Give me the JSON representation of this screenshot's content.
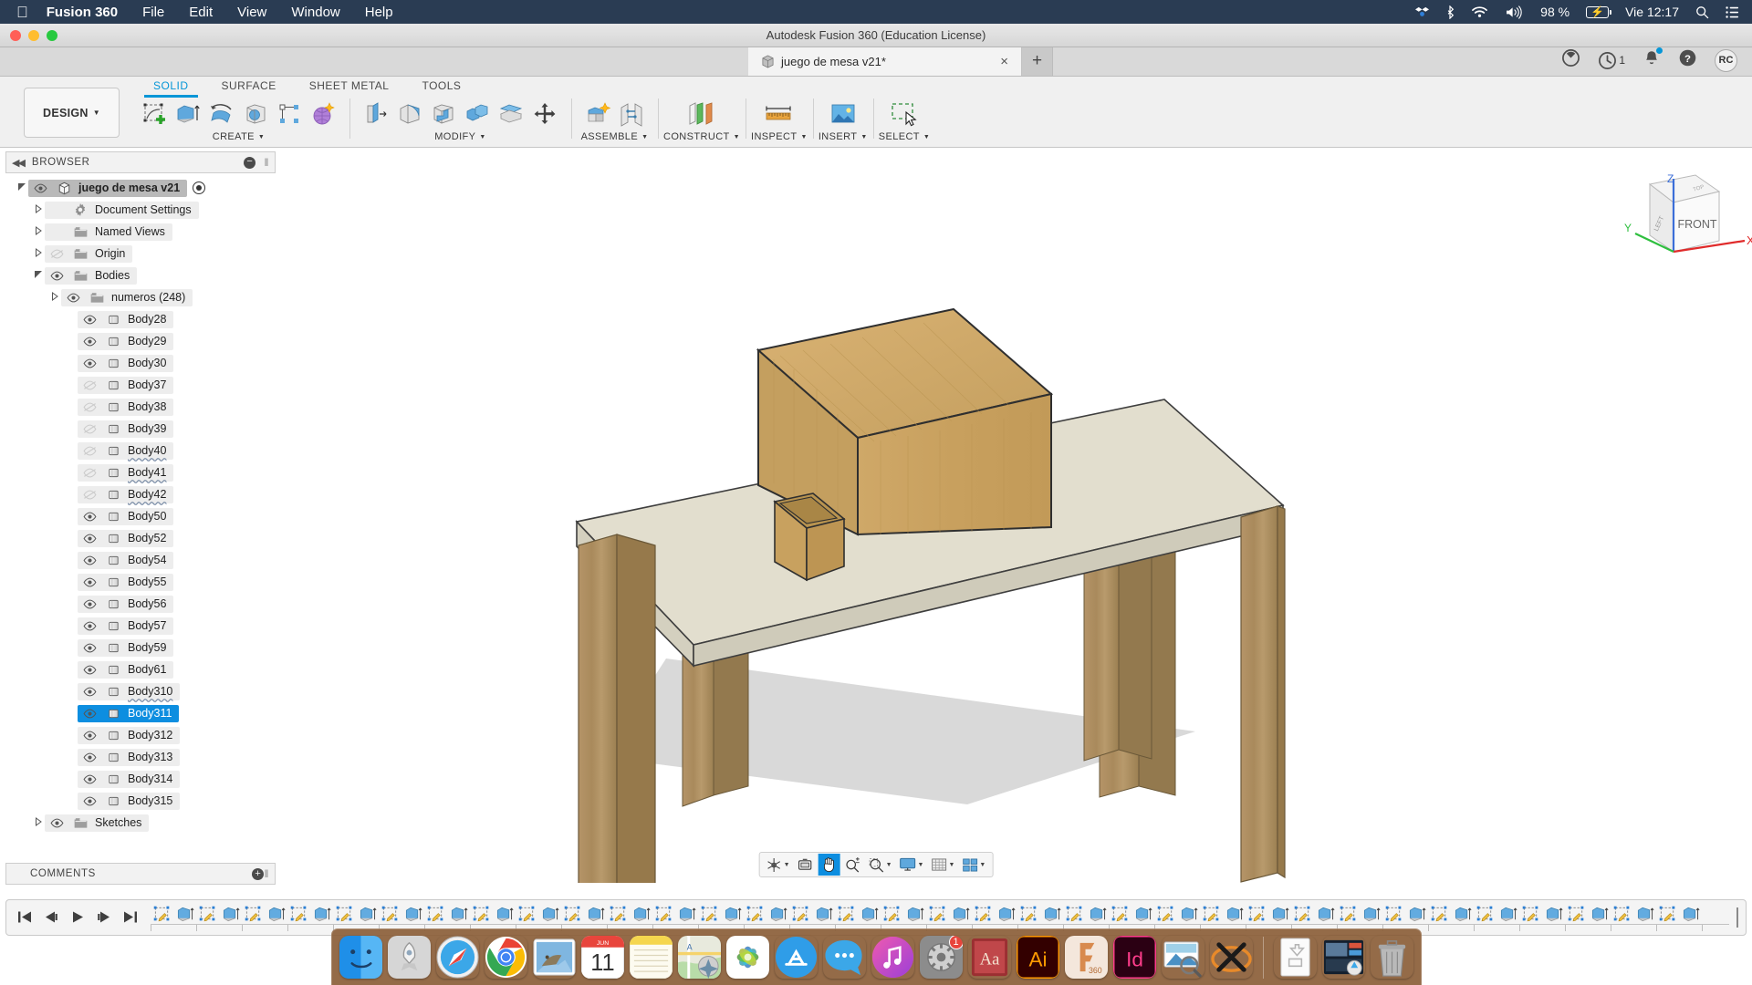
{
  "macmenu": {
    "apple_icon": "apple-logo",
    "app_name": "Fusion 360",
    "items": [
      "File",
      "Edit",
      "View",
      "Window",
      "Help"
    ],
    "status": {
      "battery_percent": "98 %",
      "clock": "Vie 12:17",
      "icons": [
        "dropbox-icon",
        "bluetooth-icon",
        "wifi-icon",
        "volume-icon",
        "battery-icon",
        "spotlight-search-icon",
        "control-center-icon"
      ]
    }
  },
  "window": {
    "title": "Autodesk Fusion 360 (Education License)",
    "traffic_lights": [
      "close",
      "minimize",
      "zoom"
    ]
  },
  "tabbar": {
    "document_tab": "juego de mesa v21*",
    "close_label": "×",
    "new_tab_label": "+",
    "notification_count": "1",
    "avatar_initials": "RC",
    "icons": [
      "job-status-icon",
      "recent-activity-icon",
      "notifications-icon",
      "help-icon",
      "account-avatar"
    ]
  },
  "ribbon": {
    "workspace": "DESIGN",
    "tabs": [
      {
        "label": "SOLID",
        "active": true
      },
      {
        "label": "SURFACE",
        "active": false
      },
      {
        "label": "SHEET METAL",
        "active": false
      },
      {
        "label": "TOOLS",
        "active": false
      }
    ],
    "panels": [
      {
        "label": "CREATE",
        "has_dropdown": true,
        "tools": [
          "create-sketch-icon",
          "extrude-icon",
          "revolve-icon",
          "sweep-icon",
          "pattern-icon",
          "create-form-icon"
        ]
      },
      {
        "label": "MODIFY",
        "has_dropdown": true,
        "tools": [
          "press-pull-icon",
          "fillet-icon",
          "shell-icon",
          "combine-icon",
          "offset-face-icon",
          "move-copy-icon"
        ]
      },
      {
        "label": "ASSEMBLE",
        "has_dropdown": true,
        "tools": [
          "new-component-icon",
          "joint-icon"
        ]
      },
      {
        "label": "CONSTRUCT",
        "has_dropdown": true,
        "tools": [
          "offset-plane-icon"
        ]
      },
      {
        "label": "INSPECT",
        "has_dropdown": true,
        "tools": [
          "measure-icon"
        ]
      },
      {
        "label": "INSERT",
        "has_dropdown": true,
        "tools": [
          "insert-image-icon"
        ]
      },
      {
        "label": "SELECT",
        "has_dropdown": true,
        "tools": [
          "select-window-icon"
        ]
      }
    ]
  },
  "browser": {
    "header": "BROWSER",
    "collapse_icon": "collapse-left-icon",
    "minus_icon": "minimize-icon",
    "tree": [
      {
        "label": "juego de mesa v21",
        "indent": 0,
        "tri": "open",
        "eye": "on",
        "icon": "component-icon",
        "root": true,
        "radio": true
      },
      {
        "label": "Document Settings",
        "indent": 1,
        "tri": "closed",
        "eye": "none",
        "icon": "gear-icon"
      },
      {
        "label": "Named Views",
        "indent": 1,
        "tri": "closed",
        "eye": "none",
        "icon": "folder-icon"
      },
      {
        "label": "Origin",
        "indent": 1,
        "tri": "closed",
        "eye": "off",
        "icon": "folder-icon"
      },
      {
        "label": "Bodies",
        "indent": 1,
        "tri": "open",
        "eye": "on",
        "icon": "folder-icon"
      },
      {
        "label": "numeros (248)",
        "indent": 2,
        "tri": "closed",
        "eye": "on",
        "icon": "folder-icon"
      },
      {
        "label": "Body28",
        "indent": 3,
        "tri": "none",
        "eye": "on",
        "icon": "body-icon"
      },
      {
        "label": "Body29",
        "indent": 3,
        "tri": "none",
        "eye": "on",
        "icon": "body-icon"
      },
      {
        "label": "Body30",
        "indent": 3,
        "tri": "none",
        "eye": "on",
        "icon": "body-icon"
      },
      {
        "label": "Body37",
        "indent": 3,
        "tri": "none",
        "eye": "off",
        "icon": "body-icon"
      },
      {
        "label": "Body38",
        "indent": 3,
        "tri": "none",
        "eye": "off",
        "icon": "body-icon"
      },
      {
        "label": "Body39",
        "indent": 3,
        "tri": "none",
        "eye": "off",
        "icon": "body-icon"
      },
      {
        "label": "Body40",
        "indent": 3,
        "tri": "none",
        "eye": "off",
        "icon": "body-icon",
        "squiggle": true
      },
      {
        "label": "Body41",
        "indent": 3,
        "tri": "none",
        "eye": "off",
        "icon": "body-icon",
        "squiggle": true
      },
      {
        "label": "Body42",
        "indent": 3,
        "tri": "none",
        "eye": "off",
        "icon": "body-icon",
        "squiggle": true
      },
      {
        "label": "Body50",
        "indent": 3,
        "tri": "none",
        "eye": "on",
        "icon": "body-icon"
      },
      {
        "label": "Body52",
        "indent": 3,
        "tri": "none",
        "eye": "on",
        "icon": "body-icon"
      },
      {
        "label": "Body54",
        "indent": 3,
        "tri": "none",
        "eye": "on",
        "icon": "body-icon"
      },
      {
        "label": "Body55",
        "indent": 3,
        "tri": "none",
        "eye": "on",
        "icon": "body-icon"
      },
      {
        "label": "Body56",
        "indent": 3,
        "tri": "none",
        "eye": "on",
        "icon": "body-icon"
      },
      {
        "label": "Body57",
        "indent": 3,
        "tri": "none",
        "eye": "on",
        "icon": "body-icon"
      },
      {
        "label": "Body59",
        "indent": 3,
        "tri": "none",
        "eye": "on",
        "icon": "body-icon"
      },
      {
        "label": "Body61",
        "indent": 3,
        "tri": "none",
        "eye": "on",
        "icon": "body-icon"
      },
      {
        "label": "Body310",
        "indent": 3,
        "tri": "none",
        "eye": "on",
        "icon": "body-icon",
        "squiggle": true
      },
      {
        "label": "Body311",
        "indent": 3,
        "tri": "none",
        "eye": "on",
        "icon": "body-icon",
        "selected": true
      },
      {
        "label": "Body312",
        "indent": 3,
        "tri": "none",
        "eye": "on",
        "icon": "body-icon"
      },
      {
        "label": "Body313",
        "indent": 3,
        "tri": "none",
        "eye": "on",
        "icon": "body-icon"
      },
      {
        "label": "Body314",
        "indent": 3,
        "tri": "none",
        "eye": "on",
        "icon": "body-icon"
      },
      {
        "label": "Body315",
        "indent": 3,
        "tri": "none",
        "eye": "on",
        "icon": "body-icon"
      },
      {
        "label": "Sketches",
        "indent": 1,
        "tri": "closed",
        "eye": "on",
        "icon": "folder-icon"
      }
    ]
  },
  "comments": {
    "header": "COMMENTS",
    "add_icon": "add-comment-icon"
  },
  "canvas": {
    "viewcube_faces": {
      "front": "FRONT",
      "top": "TOP",
      "left": "LEFT"
    },
    "axes": {
      "x": "X",
      "y": "Y",
      "z": "Z"
    },
    "model_description": "Wooden table with a large box and a small open box on the tabletop",
    "colors": {
      "tabletop": "#e0dccc",
      "wood": "#c9a15e",
      "leg_wood": "#a98a5e",
      "shadow": "#cfcfcf",
      "background": "#ffffff"
    }
  },
  "navbar": {
    "buttons": [
      {
        "name": "orbit-icon",
        "dropdown": true,
        "active": false
      },
      {
        "name": "look-at-icon",
        "dropdown": false,
        "active": false
      },
      {
        "name": "pan-hand-icon",
        "dropdown": false,
        "active": true
      },
      {
        "name": "zoom-icon",
        "dropdown": false,
        "active": false
      },
      {
        "name": "zoom-window-icon",
        "dropdown": true,
        "active": false
      },
      {
        "name": "display-settings-icon",
        "dropdown": true,
        "active": false
      },
      {
        "name": "grid-snap-icon",
        "dropdown": true,
        "active": false
      },
      {
        "name": "viewports-icon",
        "dropdown": true,
        "active": false
      }
    ]
  },
  "timeline": {
    "controls": [
      "go-to-beginning-icon",
      "step-back-icon",
      "play-icon",
      "step-forward-icon",
      "go-to-end-icon"
    ],
    "feature_sequence": [
      "sketch",
      "extrude",
      "sketch",
      "extrude",
      "sketch",
      "extrude",
      "sketch",
      "extrude",
      "sketch",
      "extrude",
      "sketch",
      "extrude",
      "sketch",
      "extrude",
      "sketch",
      "extrude",
      "sketch",
      "extrude",
      "sketch",
      "extrude",
      "sketch",
      "extrude",
      "sketch",
      "extrude",
      "sketch",
      "extrude",
      "sketch",
      "extrude",
      "sketch",
      "extrude",
      "sketch",
      "extrude",
      "sketch",
      "extrude",
      "sketch",
      "extrude",
      "sketch",
      "extrude",
      "sketch",
      "extrude",
      "sketch",
      "extrude",
      "sketch",
      "extrude",
      "sketch",
      "extrude",
      "sketch",
      "extrude",
      "sketch",
      "extrude",
      "sketch",
      "extrude",
      "sketch",
      "extrude",
      "sketch",
      "extrude",
      "sketch",
      "extrude",
      "sketch",
      "extrude",
      "sketch",
      "extrude",
      "sketch",
      "extrude",
      "sketch",
      "extrude",
      "sketch",
      "extrude"
    ],
    "marker_label": "end-marker"
  },
  "dock": {
    "items": [
      {
        "name": "finder",
        "running": true
      },
      {
        "name": "launchpad",
        "running": false
      },
      {
        "name": "safari",
        "running": true
      },
      {
        "name": "google-chrome",
        "running": false
      },
      {
        "name": "mail",
        "running": true
      },
      {
        "name": "calendar",
        "running": false,
        "day": "11",
        "month": "JUN"
      },
      {
        "name": "notes",
        "running": false
      },
      {
        "name": "maps",
        "running": false
      },
      {
        "name": "photos",
        "running": false
      },
      {
        "name": "app-store",
        "running": false
      },
      {
        "name": "messages",
        "running": false
      },
      {
        "name": "itunes",
        "running": false
      },
      {
        "name": "system-preferences",
        "running": false,
        "badge": "1"
      },
      {
        "name": "dictionary",
        "running": false
      },
      {
        "name": "adobe-illustrator",
        "running": true,
        "short": "Ai"
      },
      {
        "name": "fusion-360",
        "running": true,
        "short": "360"
      },
      {
        "name": "adobe-indesign",
        "running": true,
        "short": "Id"
      },
      {
        "name": "preview",
        "running": true
      },
      {
        "name": "xquartz",
        "running": true
      },
      {
        "name": "separator"
      },
      {
        "name": "downloads-stack",
        "running": false
      },
      {
        "name": "screenshots-folder",
        "running": false
      },
      {
        "name": "trash",
        "running": false
      }
    ]
  }
}
